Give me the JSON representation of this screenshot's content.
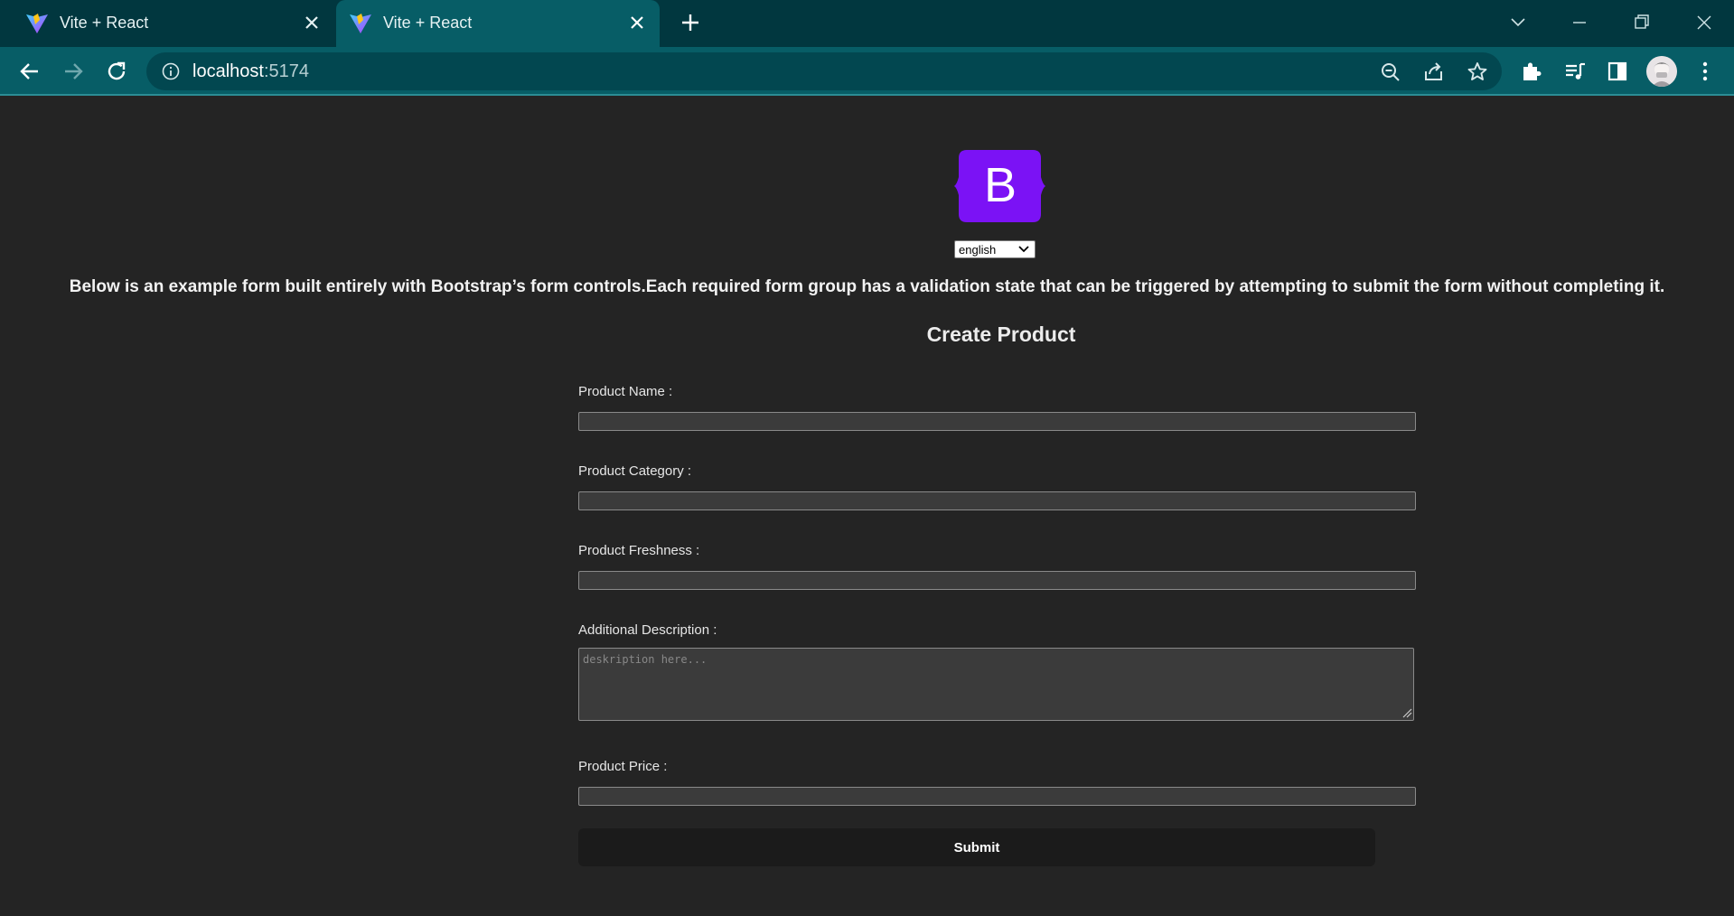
{
  "browser": {
    "tabs": [
      {
        "title": "Vite + React",
        "active": false
      },
      {
        "title": "Vite + React",
        "active": true
      }
    ],
    "url_host": "localhost",
    "url_port": ":5174"
  },
  "page": {
    "logo_letter": "B",
    "language": {
      "selected": "english",
      "options": [
        "english"
      ]
    },
    "intro": "Below is an example form built entirely with Bootstrap’s form controls.Each required form group has a validation state that can be triggered by attempting to submit the form without completing it.",
    "form": {
      "title": "Create Product",
      "fields": {
        "name_label": "Product Name :",
        "category_label": "Product Category :",
        "freshness_label": "Product Freshness :",
        "description_label": "Additional Description :",
        "description_placeholder": "deskription here...",
        "price_label": "Product Price :"
      },
      "submit_label": "Submit"
    }
  },
  "colors": {
    "tabstrip": "#01373f",
    "toolbar": "#075d66",
    "page_bg": "#242424",
    "logo": "#7b12f5"
  }
}
